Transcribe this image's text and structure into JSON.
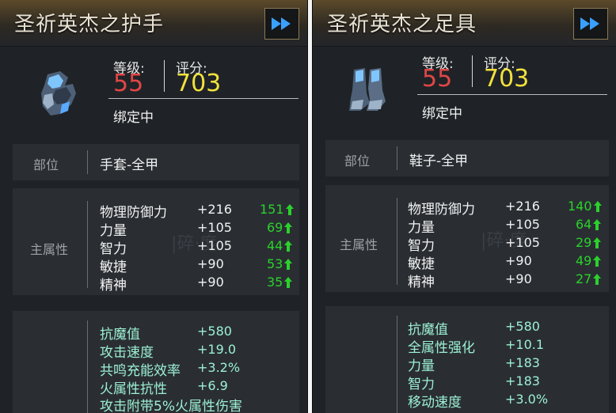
{
  "colors": {
    "level": "#e24646",
    "score": "#f2e23b",
    "compare": "#2ad22a",
    "extra": "#9cf0d2"
  },
  "panels": [
    {
      "title": "圣祈英杰之护手",
      "icon": "gauntlet-armor-icon",
      "level_label": "等级:",
      "level": "55",
      "score_label": "评分:",
      "score": "703",
      "bind_status": "绑定中",
      "slot_label": "部位",
      "slot_value": "手套-全甲",
      "main_label": "主属性",
      "stats": [
        {
          "name": "物理防御力",
          "value": "+216",
          "compare": "151"
        },
        {
          "name": "力量",
          "value": "+105",
          "compare": "69"
        },
        {
          "name": "智力",
          "value": "+105",
          "compare": "44"
        },
        {
          "name": "敏捷",
          "value": "+90",
          "compare": "53"
        },
        {
          "name": "精神",
          "value": "+90",
          "compare": "35"
        }
      ],
      "extra": [
        {
          "name": "抗魔值",
          "value": "+580"
        },
        {
          "name": "攻击速度",
          "value": "+19.0"
        },
        {
          "name": "共鸣充能效率",
          "value": "+3.2%"
        },
        {
          "name": "火属性抗性",
          "value": "+6.9"
        },
        {
          "name": "攻击附带5%火属性伤害",
          "value": ""
        }
      ]
    },
    {
      "title": "圣祈英杰之足具",
      "icon": "armored-boots-icon",
      "level_label": "等级:",
      "level": "55",
      "score_label": "评分:",
      "score": "703",
      "bind_status": "绑定中",
      "slot_label": "部位",
      "slot_value": "鞋子-全甲",
      "main_label": "主属性",
      "stats": [
        {
          "name": "物理防御力",
          "value": "+216",
          "compare": "140"
        },
        {
          "name": "力量",
          "value": "+105",
          "compare": "64"
        },
        {
          "name": "智力",
          "value": "+105",
          "compare": "29"
        },
        {
          "name": "敏捷",
          "value": "+90",
          "compare": "49"
        },
        {
          "name": "精神",
          "value": "+90",
          "compare": "27"
        }
      ],
      "extra": [
        {
          "name": "抗魔值",
          "value": "+580"
        },
        {
          "name": "全属性强化",
          "value": "+10.1"
        },
        {
          "name": "力量",
          "value": "+183"
        },
        {
          "name": "智力",
          "value": "+183"
        },
        {
          "name": "移动速度",
          "value": "+3.0%"
        }
      ]
    }
  ]
}
